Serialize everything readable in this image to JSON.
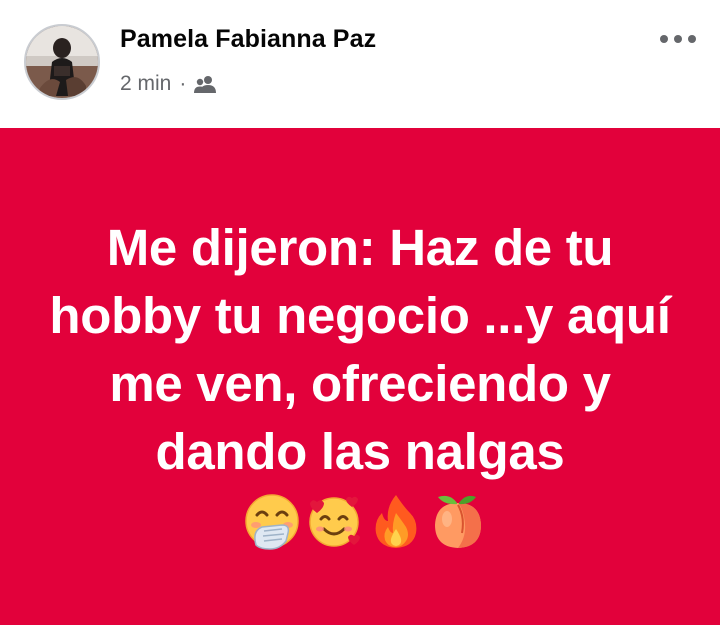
{
  "post": {
    "author_name": "Pamela Fabianna Paz",
    "timestamp": "2 min",
    "separator": "·",
    "audience_icon": "friends-icon",
    "more_icon": "more-horizontal-icon",
    "background_color": "#e2013b",
    "text_line_1": "Me dijeron: Haz de tu hobby tu negocio ...y aquí me ven, ofreciendo y dando las nalgas",
    "emojis": [
      "hand-over-mouth-emoji",
      "smiling-face-with-hearts-emoji",
      "fire-emoji",
      "peach-emoji"
    ]
  }
}
